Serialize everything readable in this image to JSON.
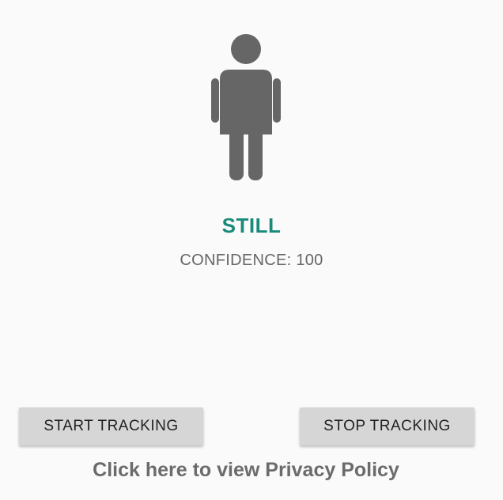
{
  "status": {
    "activity": "STILL",
    "confidence_text": "CONFIDENCE: 100",
    "activity_color": "#1a8a7a",
    "icon": "standing-person-icon"
  },
  "actions": {
    "start_label": "START TRACKING",
    "stop_label": "STOP TRACKING"
  },
  "footer": {
    "privacy_link": "Click here to view Privacy Policy"
  }
}
